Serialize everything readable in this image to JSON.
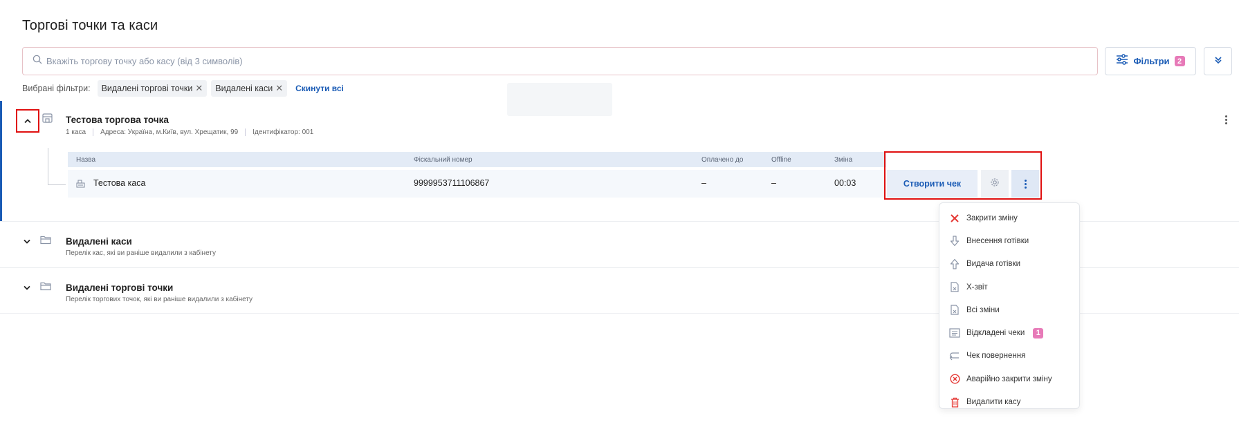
{
  "page": {
    "title": "Торгові точки та каси"
  },
  "search": {
    "placeholder": "Вкажіть торгову точку або касу (від 3 символів)"
  },
  "filters": {
    "label": "Фільтри",
    "count": "2"
  },
  "selected_filters": {
    "label": "Вибрані фільтри:",
    "chips": [
      "Видалені торгові точки",
      "Видалені каси"
    ],
    "reset_label": "Скинути всі"
  },
  "store": {
    "title": "Тестова торгова точка",
    "meta": [
      "1 каса",
      "Адреса: Україна, м.Київ, вул. Хрещатик, 99",
      "Ідентифікатор: 001"
    ]
  },
  "table": {
    "headers": [
      "Назва",
      "Фіскальний номер",
      "Оплачено до",
      "Offline",
      "Зміна"
    ],
    "row": {
      "name": "Тестова каса",
      "fiscal_number": "9999953711106867",
      "paid_until": "–",
      "offline": "–",
      "shift": "00:03"
    },
    "create_receipt_label": "Створити чек"
  },
  "folders": [
    {
      "title": "Видалені каси",
      "subtitle": "Перелік кас, які ви раніше видалили з кабінету"
    },
    {
      "title": "Видалені торгові точки",
      "subtitle": "Перелік торгових точок, які ви раніше видалили з кабінету"
    }
  ],
  "menu": {
    "items": [
      {
        "label": "Закрити зміну",
        "icon": "close-x-icon",
        "color": "#e53935"
      },
      {
        "label": "Внесення готівки",
        "icon": "arrow-down-icon",
        "color": "#8a94a6"
      },
      {
        "label": "Видача готівки",
        "icon": "arrow-up-icon",
        "color": "#8a94a6"
      },
      {
        "label": "Х-звіт",
        "icon": "document-icon",
        "color": "#8a94a6"
      },
      {
        "label": "Всі зміни",
        "icon": "document-icon",
        "color": "#8a94a6"
      },
      {
        "label": "Відкладені чеки",
        "icon": "list-icon",
        "color": "#8a94a6",
        "badge": "1"
      },
      {
        "label": "Чек повернення",
        "icon": "return-arrow-icon",
        "color": "#8a94a6"
      },
      {
        "label": "Аварійно закрити зміну",
        "icon": "circle-x-icon",
        "color": "#e53935"
      },
      {
        "label": "Видалити касу",
        "icon": "trash-icon",
        "color": "#e53935"
      }
    ]
  },
  "colors": {
    "accent": "#1a5bb5",
    "badge": "#e77ab8",
    "highlight": "#e01010",
    "danger": "#e53935"
  }
}
